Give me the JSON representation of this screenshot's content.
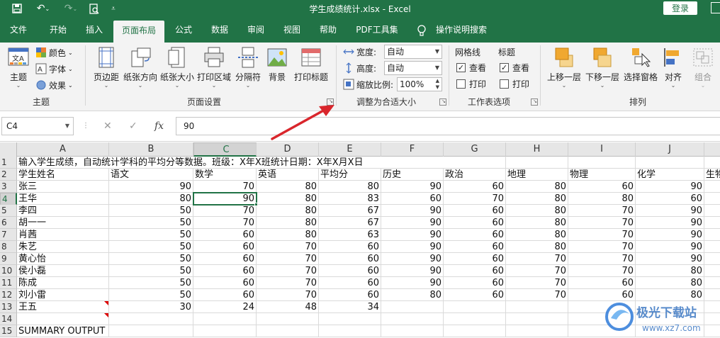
{
  "window": {
    "title": "学生成绩统计.xlsx  -  Excel",
    "login_label": "登录"
  },
  "tabs": [
    {
      "label": "文件"
    },
    {
      "label": "开始"
    },
    {
      "label": "插入"
    },
    {
      "label": "页面布局"
    },
    {
      "label": "公式"
    },
    {
      "label": "数据"
    },
    {
      "label": "审阅"
    },
    {
      "label": "视图"
    },
    {
      "label": "帮助"
    },
    {
      "label": "PDF工具集"
    },
    {
      "label": "操作说明搜索"
    }
  ],
  "ribbon": {
    "theme_group": {
      "label": "主题",
      "theme_btn": "主题",
      "colors": "颜色",
      "fonts": "字体",
      "effects": "效果"
    },
    "page_setup_group": {
      "label": "页面设置",
      "buttons": [
        "页边距",
        "纸张方向",
        "纸张大小",
        "打印区域",
        "分隔符",
        "背景",
        "打印标题"
      ]
    },
    "scale_group": {
      "label": "调整为合适大小",
      "width_label": "宽度:",
      "width_value": "自动",
      "height_label": "高度:",
      "height_value": "自动",
      "scale_label": "缩放比例:",
      "scale_value": "100%"
    },
    "sheet_options_group": {
      "label": "工作表选项",
      "gridlines": "网格线",
      "headings": "标题",
      "view": "查看",
      "print": "打印"
    },
    "arrange_group": {
      "label": "排列",
      "buttons": [
        "上移一层",
        "下移一层",
        "选择窗格",
        "对齐",
        "组合"
      ]
    }
  },
  "formula_bar": {
    "name_box": "C4",
    "cancel_glyph": "✕",
    "enter_glyph": "✓",
    "fx_glyph": "fx",
    "value": "90"
  },
  "sheet": {
    "columns": [
      "A",
      "B",
      "C",
      "D",
      "E",
      "F",
      "G",
      "H",
      "I",
      "J"
    ],
    "rows": [
      "1",
      "2",
      "3",
      "4",
      "5",
      "6",
      "7",
      "8",
      "9",
      "10",
      "11",
      "12",
      "13",
      "14",
      "15"
    ],
    "row1_text": "输入学生成绩，自动统计学科的平均分等数据。班级：X年X班统计日期：X年X月X日",
    "headers": [
      "学生姓名",
      "语文",
      "数学",
      "英语",
      "平均分",
      "历史",
      "政治",
      "地理",
      "物理",
      "化学",
      "生物"
    ],
    "students": [
      {
        "name": "张三",
        "scores": [
          "90",
          "70",
          "80",
          "80",
          "90",
          "60",
          "80",
          "60",
          "90"
        ]
      },
      {
        "name": "王华",
        "scores": [
          "80",
          "90",
          "80",
          "83",
          "60",
          "70",
          "80",
          "80",
          "60"
        ]
      },
      {
        "name": "李四",
        "scores": [
          "50",
          "70",
          "80",
          "67",
          "90",
          "60",
          "80",
          "70",
          "90"
        ]
      },
      {
        "name": "胡一一",
        "scores": [
          "50",
          "70",
          "80",
          "67",
          "90",
          "60",
          "80",
          "70",
          "90"
        ]
      },
      {
        "name": "肖茜",
        "scores": [
          "50",
          "60",
          "80",
          "63",
          "90",
          "60",
          "80",
          "70",
          "90"
        ]
      },
      {
        "name": "朱艺",
        "scores": [
          "50",
          "60",
          "70",
          "60",
          "90",
          "60",
          "80",
          "70",
          "90"
        ]
      },
      {
        "name": "黄心怡",
        "scores": [
          "50",
          "60",
          "70",
          "60",
          "90",
          "60",
          "70",
          "70",
          "90"
        ]
      },
      {
        "name": "侯小磊",
        "scores": [
          "50",
          "60",
          "70",
          "60",
          "90",
          "60",
          "70",
          "70",
          "80"
        ]
      },
      {
        "name": "陈成",
        "scores": [
          "50",
          "60",
          "70",
          "60",
          "90",
          "60",
          "70",
          "60",
          "80"
        ]
      },
      {
        "name": "刘小雷",
        "scores": [
          "50",
          "60",
          "70",
          "60",
          "80",
          "60",
          "70",
          "60",
          "80"
        ]
      },
      {
        "name": "王五",
        "scores": [
          "30",
          "24",
          "48",
          "34",
          "",
          "",
          "",
          "",
          ""
        ]
      }
    ],
    "row15_text": "SUMMARY OUTPUT"
  },
  "watermark": {
    "name": "极光下载站",
    "url": "www.xz7.com"
  },
  "colors": {
    "brand": "#217346",
    "arrow": "#d9262c"
  }
}
